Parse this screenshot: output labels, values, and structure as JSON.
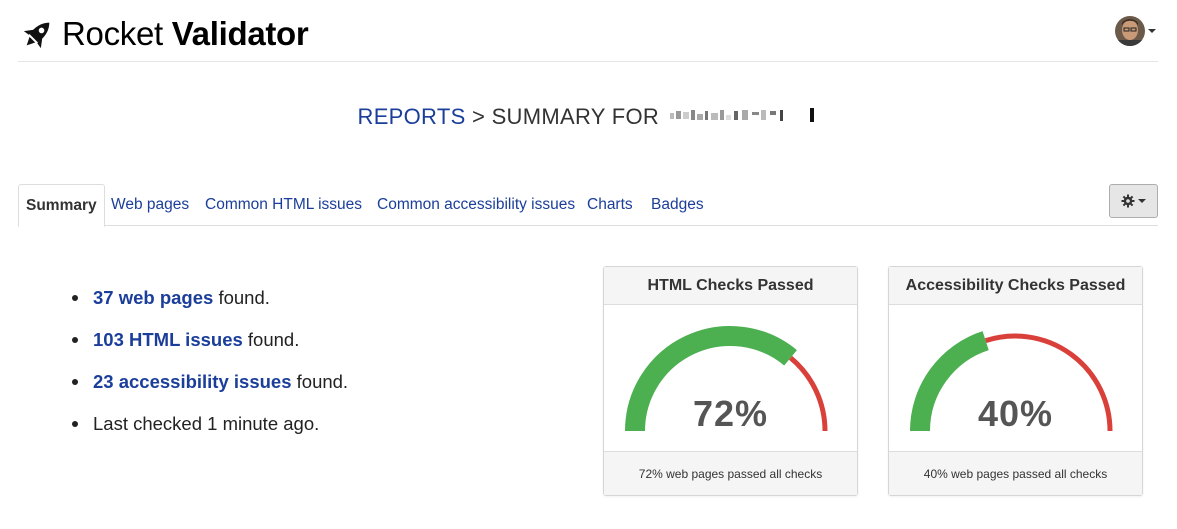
{
  "header": {
    "brand_light": "Rocket",
    "brand_bold": "Validator",
    "icon": "rocket-icon",
    "user_icon": "avatar-image"
  },
  "breadcrumb": {
    "link": "REPORTS",
    "separator": ">",
    "current": "SUMMARY FOR"
  },
  "tabs": [
    {
      "label": "Summary",
      "active": true
    },
    {
      "label": "Web pages",
      "active": false
    },
    {
      "label": "Common HTML issues",
      "active": false
    },
    {
      "label": "Common accessibility issues",
      "active": false
    },
    {
      "label": "Charts",
      "active": false
    },
    {
      "label": "Badges",
      "active": false
    }
  ],
  "settings_icon": "gear-icon",
  "summary": [
    {
      "link": "37 web pages",
      "text": " found."
    },
    {
      "link": "103 HTML issues",
      "text": " found."
    },
    {
      "link": "23 accessibility issues",
      "text": " found."
    },
    {
      "text": "Last checked 1 minute ago."
    }
  ],
  "gauges": [
    {
      "title": "HTML Checks Passed",
      "value": 72,
      "value_label": "72%",
      "footer": "72% web pages passed all checks"
    },
    {
      "title": "Accessibility Checks Passed",
      "value": 40,
      "value_label": "40%",
      "footer": "40% web pages passed all checks"
    }
  ],
  "colors": {
    "pass": "#4caf50",
    "fail": "#d9403a",
    "link": "#1a3e9a"
  }
}
